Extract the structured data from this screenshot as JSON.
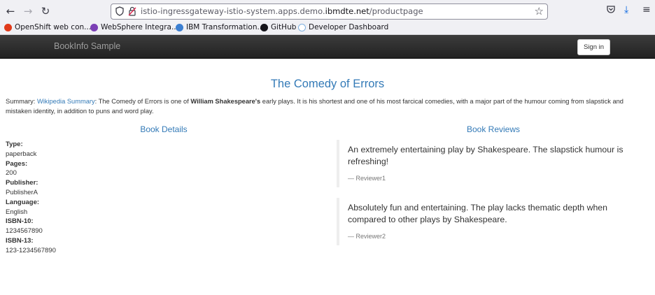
{
  "browser": {
    "url_prefix": "istio-ingressgateway-istio-system.apps.demo.",
    "url_domain": "ibmdte.net",
    "url_path": "/productpage",
    "bookmarks": [
      {
        "label": "OpenShift web con...",
        "icon": "openshift-icon",
        "color": "#e03a1a"
      },
      {
        "label": "WebSphere Integra...",
        "icon": "websphere-icon",
        "color": "#7b3fb5"
      },
      {
        "label": "IBM Transformation...",
        "icon": "ibm-icon",
        "color": "#3c7fd1"
      },
      {
        "label": "GitHub",
        "icon": "github-icon",
        "color": "#15141a"
      },
      {
        "label": "Developer Dashboard",
        "icon": "cloud-icon",
        "color": "#7fb0e0"
      }
    ]
  },
  "navbar": {
    "brand": "BookInfo Sample",
    "signin_label": "Sign in"
  },
  "product": {
    "title": "The Comedy of Errors",
    "summary_prefix": "Summary: ",
    "summary_link": "Wikipedia Summary",
    "summary_mid": ": The Comedy of Errors is one of ",
    "summary_bold": "William Shakespeare's",
    "summary_rest": " early plays. It is his shortest and one of his most farcical comedies, with a major part of the humour coming from slapstick and mistaken identity, in addition to puns and word play."
  },
  "details": {
    "heading": "Book Details",
    "fields": [
      {
        "label": "Type:",
        "value": "paperback"
      },
      {
        "label": "Pages:",
        "value": "200"
      },
      {
        "label": "Publisher:",
        "value": "PublisherA"
      },
      {
        "label": "Language:",
        "value": "English"
      },
      {
        "label": "ISBN-10:",
        "value": "1234567890"
      },
      {
        "label": "ISBN-13:",
        "value": "123-1234567890"
      }
    ]
  },
  "reviews": {
    "heading": "Book Reviews",
    "items": [
      {
        "text": "An extremely entertaining play by Shakespeare. The slapstick humour is refreshing!",
        "reviewer": "— Reviewer1"
      },
      {
        "text": "Absolutely fun and entertaining. The play lacks thematic depth when compared to other plays by Shakespeare.",
        "reviewer": "— Reviewer2"
      }
    ]
  },
  "colors": {
    "accent": "#337ab7",
    "navbar": "#222222"
  }
}
